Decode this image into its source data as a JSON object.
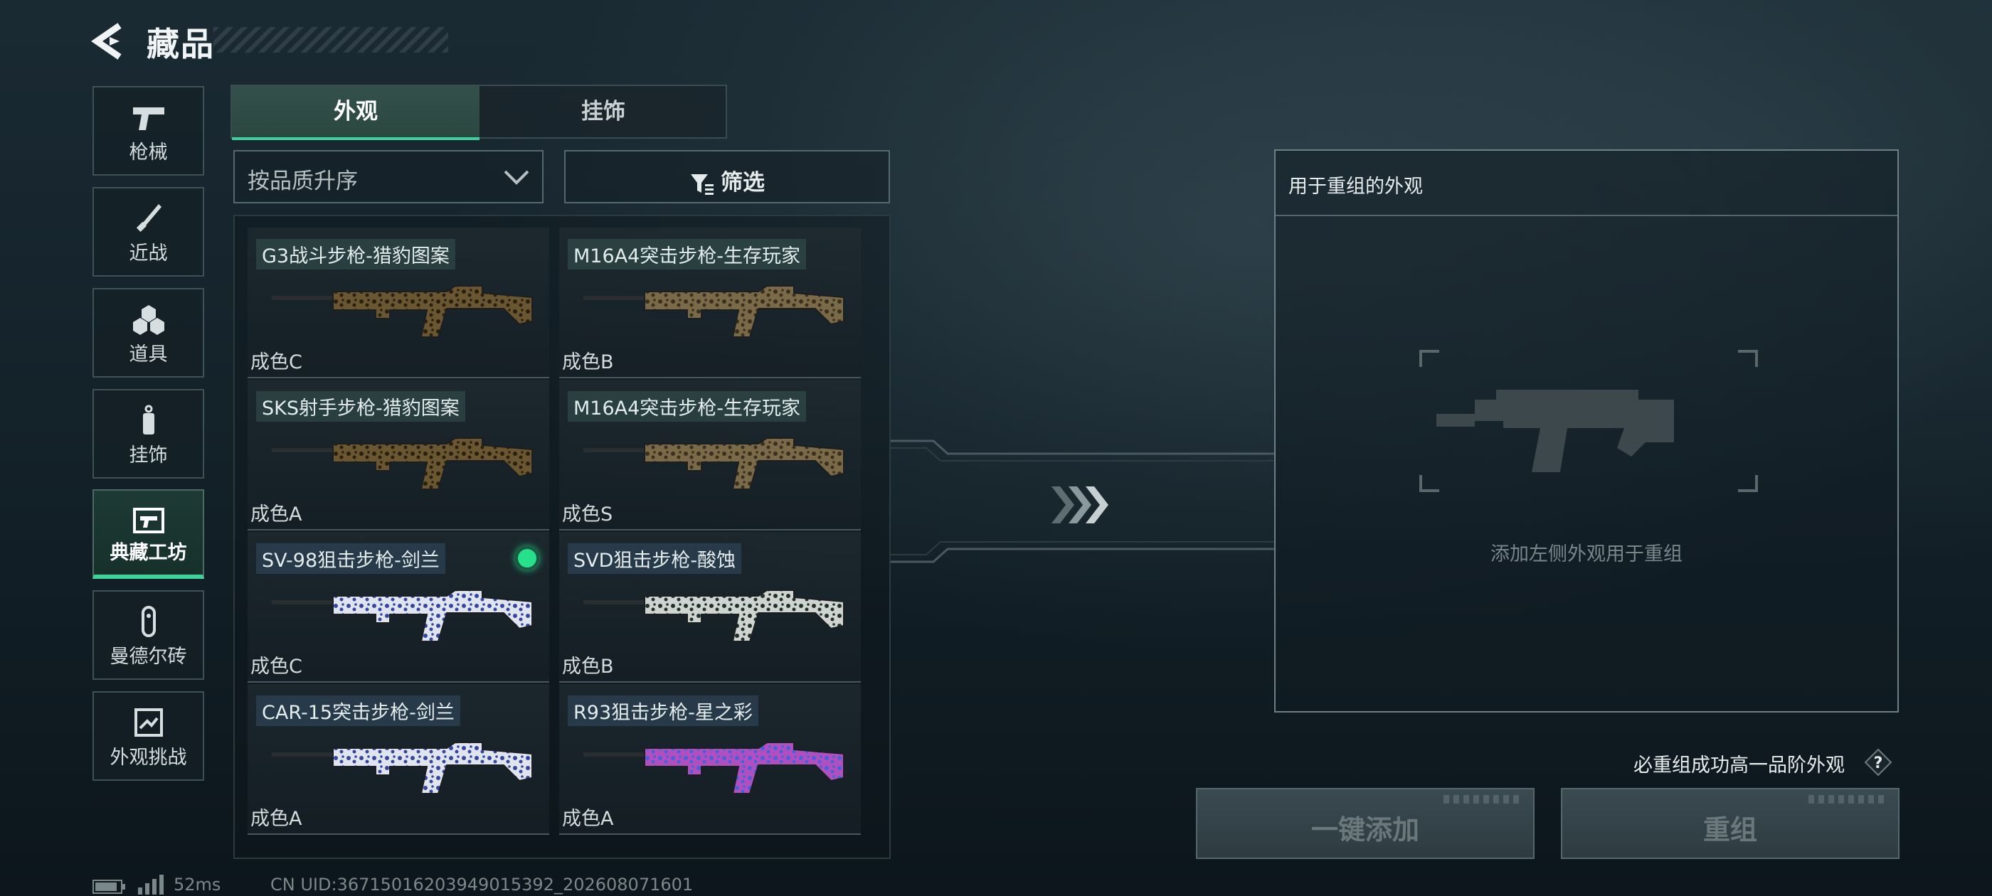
{
  "header": {
    "title": "藏品"
  },
  "nav": {
    "items": [
      {
        "label": "枪械",
        "icon": "pistol-icon",
        "active": false
      },
      {
        "label": "近战",
        "icon": "knife-icon",
        "active": false
      },
      {
        "label": "道具",
        "icon": "grenade-icon",
        "active": false
      },
      {
        "label": "挂饰",
        "icon": "charm-icon",
        "active": false
      },
      {
        "label": "典藏工坊",
        "icon": "workshop-icon",
        "active": true
      },
      {
        "label": "曼德尔砖",
        "icon": "mandel-brick-icon",
        "active": false
      },
      {
        "label": "外观挑战",
        "icon": "skin-challenge-icon",
        "active": false
      }
    ]
  },
  "tabs": [
    {
      "label": "外观",
      "active": true
    },
    {
      "label": "挂饰",
      "active": false
    }
  ],
  "sort": {
    "label": "按品质升序"
  },
  "filter": {
    "label": "筛选"
  },
  "items": [
    {
      "name": "G3战斗步枪-猎豹图案",
      "grade": "成色C",
      "skin": "leopard",
      "selected": false
    },
    {
      "name": "M16A4突击步枪-生存玩家",
      "grade": "成色B",
      "skin": "camo",
      "selected": false
    },
    {
      "name": "SKS射手步枪-猎豹图案",
      "grade": "成色A",
      "skin": "leopard",
      "selected": false
    },
    {
      "name": "M16A4突击步枪-生存玩家",
      "grade": "成色S",
      "skin": "camo",
      "selected": false
    },
    {
      "name": "SV-98狙击步枪-剑兰",
      "grade": "成色C",
      "skin": "porcelain",
      "selected": true
    },
    {
      "name": "SVD狙击步枪-酸蚀",
      "grade": "成色B",
      "skin": "acid",
      "selected": false
    },
    {
      "name": "CAR-15突击步枪-剑兰",
      "grade": "成色A",
      "skin": "porcelain",
      "selected": false
    },
    {
      "name": "R93狙击步枪-星之彩",
      "grade": "成色A",
      "skin": "galaxy",
      "selected": false
    }
  ],
  "reorg": {
    "title": "用于重组的外观",
    "hint": "添加左侧外观用于重组",
    "guarantee": "必重组成功高一品阶外观",
    "add_all_label": "一键添加",
    "reorg_label": "重组"
  },
  "status": {
    "ping": "52ms",
    "uid": "CN UID:36715016203949015392_202608071601"
  },
  "colors": {
    "accent": "#3ed39b",
    "selected": "#27e08a"
  }
}
